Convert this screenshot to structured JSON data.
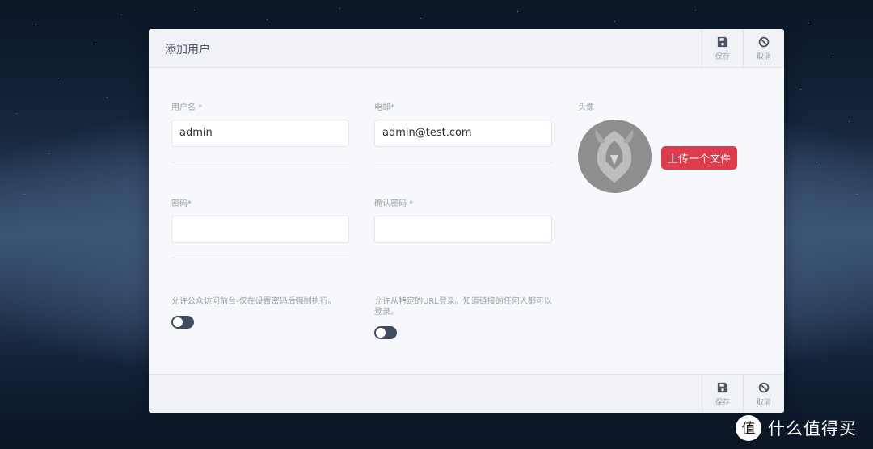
{
  "modal": {
    "title": "添加用户",
    "header_actions": [
      {
        "label": "保存",
        "icon": "save-icon"
      },
      {
        "label": "取消",
        "icon": "cancel-icon"
      }
    ],
    "footer_actions": [
      {
        "label": "保存",
        "icon": "save-icon"
      },
      {
        "label": "取消",
        "icon": "cancel-icon"
      }
    ]
  },
  "form": {
    "username": {
      "label": "用户名 *",
      "value": "admin"
    },
    "email": {
      "label": "电邮*",
      "value": "admin@test.com"
    },
    "password": {
      "label": "密码*",
      "value": ""
    },
    "confirm_password": {
      "label": "确认密码 *",
      "value": ""
    },
    "avatar": {
      "label": "头像",
      "upload_label": "上传一个文件"
    },
    "public_access": {
      "label": "允许公众访问前台-仅在设置密码后强制执行。",
      "enabled": false
    },
    "url_login": {
      "label": "允许从特定的URL登录。知道链接的任何人都可以登录。",
      "enabled": false
    }
  },
  "watermark": {
    "text": "什么值得买",
    "logo": "值"
  },
  "colors": {
    "accent": "#dc3c4c",
    "toggle": "#414b5f",
    "icon": "#4a5263"
  }
}
